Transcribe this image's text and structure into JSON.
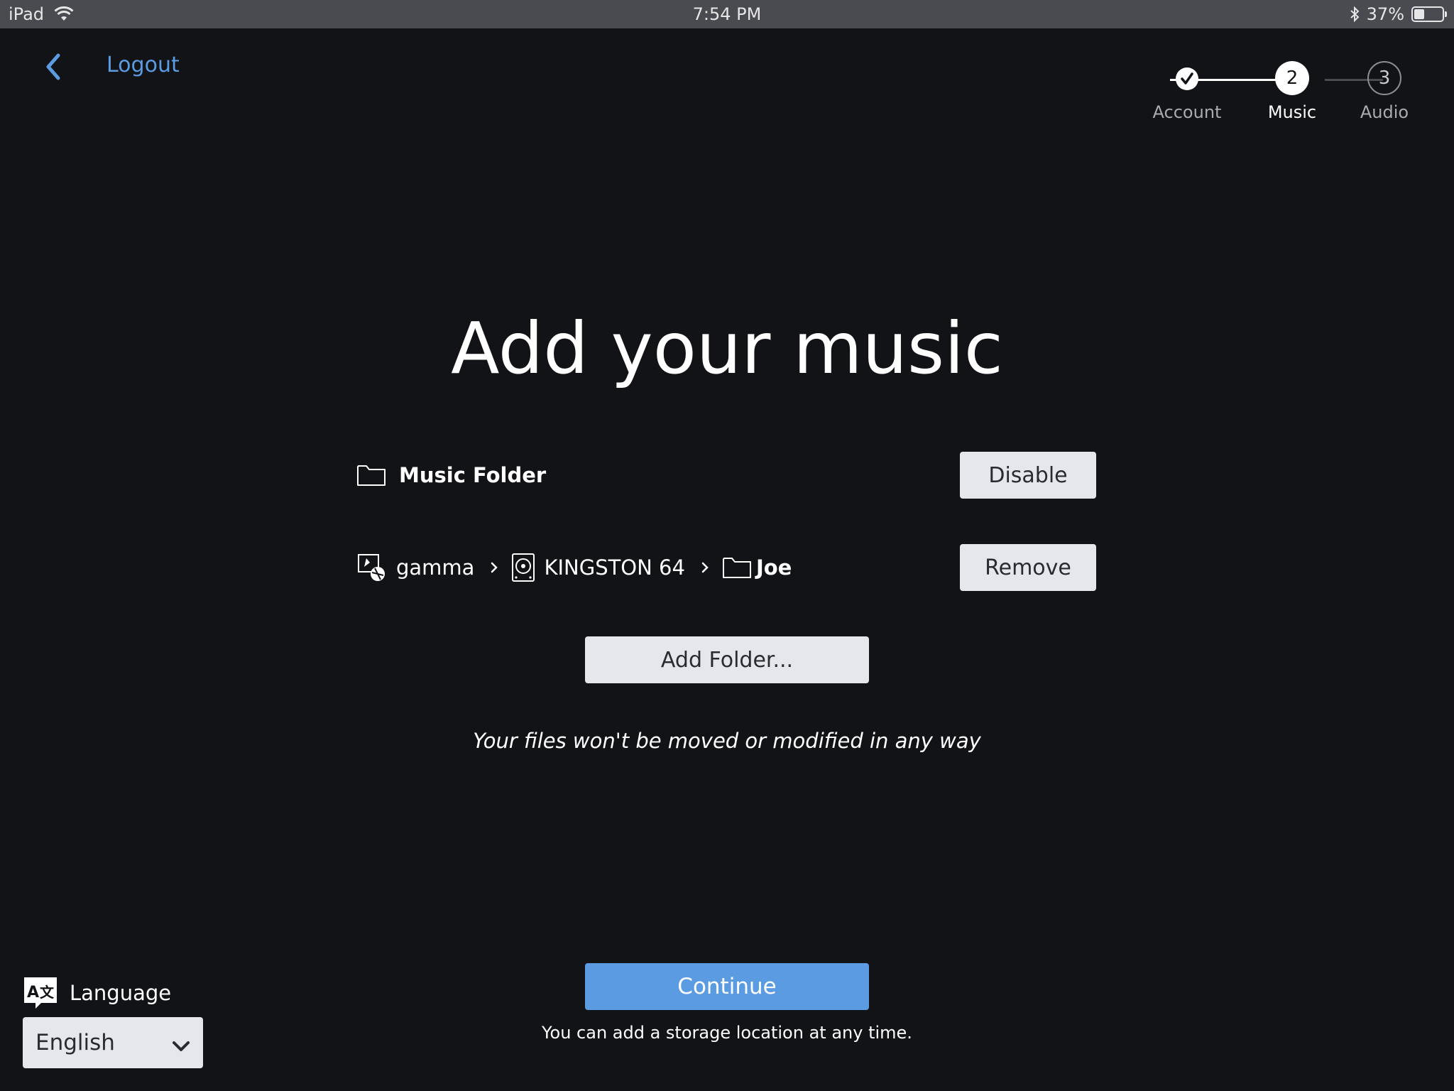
{
  "status_bar": {
    "device": "iPad",
    "time": "7:54 PM",
    "battery_percent_text": "37%",
    "battery_level": 0.37
  },
  "nav": {
    "logout_label": "Logout"
  },
  "stepper": {
    "steps": [
      {
        "number": "✓",
        "label": "Account",
        "state": "done"
      },
      {
        "number": "2",
        "label": "Music",
        "state": "current"
      },
      {
        "number": "3",
        "label": "Audio",
        "state": "upcoming"
      }
    ]
  },
  "main": {
    "title": "Add your music",
    "music_folder": {
      "label": "Music Folder",
      "button_label": "Disable"
    },
    "path": {
      "server": "gamma",
      "drive": "KINGSTON 64",
      "folder": "Joe",
      "button_label": "Remove"
    },
    "add_folder_label": "Add Folder...",
    "note": "Your files won't be moved or modified in any way",
    "continue_label": "Continue",
    "hint": "You can add a storage location at any time."
  },
  "language": {
    "label": "Language",
    "selected": "English"
  },
  "colors": {
    "background": "#121317",
    "accent": "#5b9be2",
    "button_bg": "#e6e7ec",
    "status_bar": "#4a4b50"
  },
  "icons": {
    "wifi": "wifi-icon",
    "bluetooth": "bluetooth-icon",
    "back": "chevron-left-icon",
    "folder": "folder-icon",
    "server": "server-icon",
    "drive": "hard-drive-icon",
    "breadcrumb_separator": "chevron-right-icon",
    "language": "translate-icon",
    "dropdown": "chevron-down-icon"
  }
}
